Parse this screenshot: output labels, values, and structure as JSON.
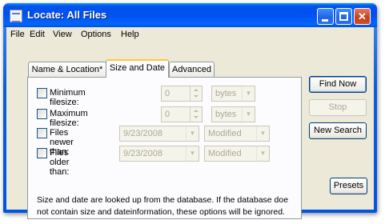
{
  "window": {
    "title": "Locate: All Files"
  },
  "menu": [
    "File",
    "Edit",
    "View",
    "Options",
    "Help"
  ],
  "tabs": [
    {
      "label": "Name & Location*"
    },
    {
      "label": "Size and Date"
    },
    {
      "label": "Advanced"
    }
  ],
  "active_tab": "Size and Date",
  "filters": {
    "min_filesize": {
      "label": "Minimum filesize:",
      "value": "0",
      "unit": "bytes",
      "checked": false
    },
    "max_filesize": {
      "label": "Maximum filesize:",
      "value": "0",
      "unit": "bytes",
      "checked": false
    },
    "newer_than": {
      "label": "Files newer than:",
      "date": "9/23/2008",
      "mode": "Modified",
      "checked": false
    },
    "older_than": {
      "label": "Files older than:",
      "date": "9/23/2008",
      "mode": "Modified",
      "checked": false
    }
  },
  "hint": {
    "line1": "Size and date are looked up from the database. If the database doe",
    "line2": "not contain size and dateinformation, these options will be ignored."
  },
  "buttons": {
    "find_now": "Find Now",
    "stop": "Stop",
    "new_search": "New Search",
    "presets": "Presets"
  }
}
